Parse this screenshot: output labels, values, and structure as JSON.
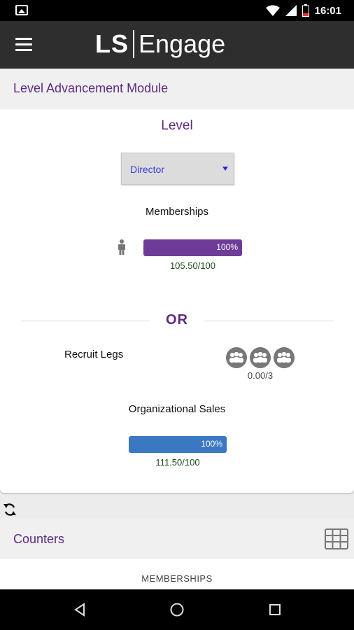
{
  "status_bar": {
    "time": "16:01",
    "icons": [
      "image-icon",
      "wifi-icon",
      "signal-icon",
      "battery-icon"
    ]
  },
  "app_bar": {
    "logo_ls": "LS",
    "logo_engage": "Engage"
  },
  "level_module": {
    "title": "Level Advancement Module",
    "level_label": "Level",
    "level_selected": "Director",
    "memberships_label": "Memberships",
    "memberships_progress": {
      "percent_label": "100%",
      "fraction": 1.0,
      "value_text": "105.50/100",
      "color": "#6e3c98"
    },
    "or_text": "OR",
    "recruit_legs_label": "Recruit Legs",
    "recruit_legs_value": "0.00/3",
    "org_sales_label": "Organizational Sales",
    "org_sales_progress": {
      "percent_label": "100%",
      "fraction": 1.0,
      "value_text": "111.50/100",
      "color": "#3a78c2"
    }
  },
  "counters": {
    "title": "Counters",
    "sub_label": "MEMBERSHIPS"
  },
  "colors": {
    "accent": "#5c2a82",
    "app_bar": "#2e2e2e"
  }
}
